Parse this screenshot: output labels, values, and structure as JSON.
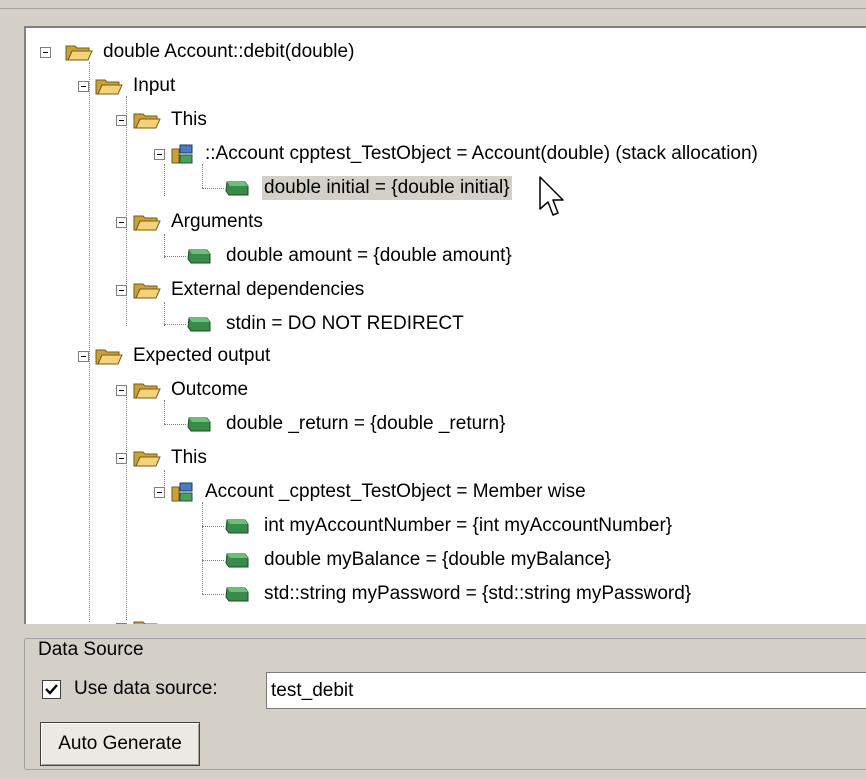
{
  "tree": {
    "nodes": [
      {
        "label": "double Account::debit(double)",
        "icon": "folder-open-icon"
      },
      {
        "label": "Input",
        "icon": "folder-open-icon"
      },
      {
        "label": "This",
        "icon": "folder-open-icon"
      },
      {
        "label": "::Account cpptest_TestObject = Account(double) (stack allocation)",
        "icon": "object-icon"
      },
      {
        "label": "double initial = {double initial}",
        "icon": "value-icon"
      },
      {
        "label": "Arguments",
        "icon": "folder-open-icon"
      },
      {
        "label": "double amount = {double amount}",
        "icon": "value-icon"
      },
      {
        "label": "External dependencies",
        "icon": "folder-open-icon"
      },
      {
        "label": "stdin = DO NOT REDIRECT",
        "icon": "value-icon"
      },
      {
        "label": "Expected output",
        "icon": "folder-open-icon"
      },
      {
        "label": "Outcome",
        "icon": "folder-open-icon"
      },
      {
        "label": "double _return = {double _return}",
        "icon": "value-icon"
      },
      {
        "label": "This",
        "icon": "folder-open-icon"
      },
      {
        "label": "Account _cpptest_TestObject = Member wise",
        "icon": "object-icon"
      },
      {
        "label": "int myAccountNumber = {int myAccountNumber}",
        "icon": "value-icon"
      },
      {
        "label": "double myBalance = {double myBalance}",
        "icon": "value-icon"
      },
      {
        "label": "std::string myPassword = {std::string myPassword}",
        "icon": "value-icon"
      }
    ],
    "selected_index": 4
  },
  "data_source": {
    "group_title": "Data Source",
    "checkbox_label": "Use data source:",
    "checkbox_checked": true,
    "input_value": "test_debit",
    "auto_generate_label": "Auto Generate"
  },
  "colors": {
    "background": "#d4d0c8",
    "folder": "#e8c25a",
    "leaf": "#3a8a4a"
  }
}
